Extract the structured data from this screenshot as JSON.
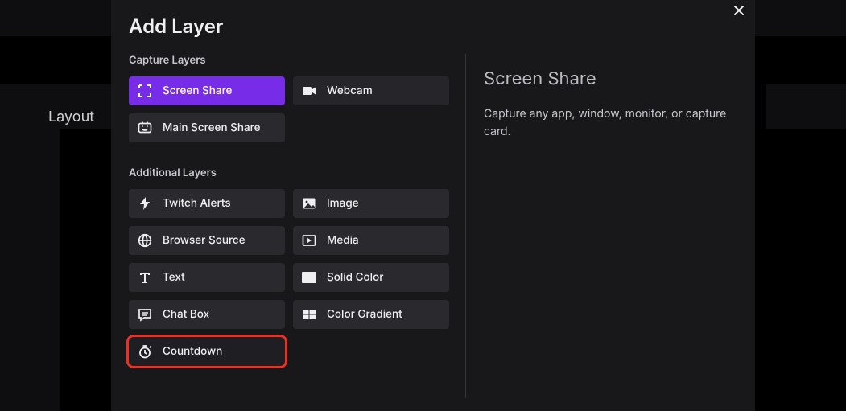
{
  "bg": {
    "layout_label": "Layout"
  },
  "modal": {
    "title": "Add Layer",
    "section_capture": "Capture Layers",
    "section_additional": "Additional Layers",
    "tiles": {
      "screen_share": "Screen Share",
      "webcam": "Webcam",
      "main_screen_share": "Main Screen Share",
      "twitch_alerts": "Twitch Alerts",
      "image": "Image",
      "browser_source": "Browser Source",
      "media": "Media",
      "text": "Text",
      "solid_color": "Solid Color",
      "chat_box": "Chat Box",
      "color_gradient": "Color Gradient",
      "countdown": "Countdown"
    }
  },
  "detail": {
    "title": "Screen Share",
    "description": "Capture any app, window, monitor, or capture card."
  }
}
